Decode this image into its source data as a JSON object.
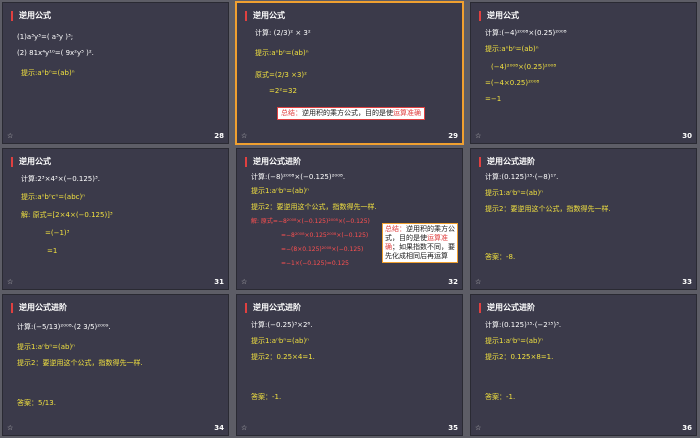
{
  "slides": [
    {
      "number": "28",
      "title": "逆用公式",
      "lines": [
        {
          "text": "(1)a³y³=( a³y )³;",
          "color": "w"
        },
        {
          "text": "(2) 81x⁴y¹⁰=( 9x²y⁵ )².",
          "color": "w"
        },
        {
          "text": "提示:aⁿbⁿ=(ab)ⁿ",
          "color": "y"
        }
      ]
    },
    {
      "number": "29",
      "title": "逆用公式",
      "lines": [
        {
          "text": "计算: (2/3)² × 3²",
          "color": "w"
        },
        {
          "text": "提示:aⁿbⁿ=(ab)ⁿ",
          "color": "y"
        },
        {
          "text": "原式=(2/3 ×3)²",
          "color": "y"
        },
        {
          "text": "=2²=32",
          "color": "y"
        }
      ],
      "note_prefix": "总结：",
      "note_body": "逆用积的乘方公式，目的是使",
      "note_highlight": "运算准确"
    },
    {
      "number": "30",
      "title": "逆用公式",
      "lines": [
        {
          "text": "计算:(−4)²⁰⁰⁸×(0.25)²⁰⁰⁸",
          "color": "w"
        },
        {
          "text": "提示:aⁿbⁿ=(ab)ⁿ",
          "color": "y"
        },
        {
          "text": "(−4)²⁰⁰⁸×(0.25)²⁰⁰⁸",
          "color": "y"
        },
        {
          "text": "=(−4×0.25)²⁰⁰⁸",
          "color": "y"
        },
        {
          "text": "=−1",
          "color": "y"
        }
      ]
    },
    {
      "number": "31",
      "title": "逆用公式",
      "lines": [
        {
          "text": "计算:2³×4³×(−0.125)³.",
          "color": "w"
        },
        {
          "text": "提示:aⁿbⁿcⁿ=(abc)ⁿ",
          "color": "y"
        },
        {
          "text": "解: 原式=[2×4×(−0.125)]³",
          "color": "y"
        },
        {
          "text": "=(−1)³",
          "color": "y"
        },
        {
          "text": "=1",
          "color": "y"
        }
      ]
    },
    {
      "number": "32",
      "title": "逆用公式进阶",
      "lines": [
        {
          "text": "计算:(−8)²⁰⁰⁸×(−0.125)²⁰⁰⁸.",
          "color": "w"
        },
        {
          "text": "提示1:aⁿbⁿ=(ab)ⁿ",
          "color": "y"
        },
        {
          "text": "提示2：要逆用这个公式，指数得先一样.",
          "color": "y"
        },
        {
          "text": "解: 原式=−8²⁰⁰⁸×(−0.125)²⁰⁰⁸×(−0.125)",
          "color": "r"
        },
        {
          "text": "=−8²⁰⁰⁸×0.125²⁰⁰⁸×(−0.125)",
          "color": "r"
        },
        {
          "text": "=−(8×0.125)²⁰⁰⁸×(−0.125)",
          "color": "r"
        },
        {
          "text": "=−1×(−0.125)=0.125",
          "color": "r"
        }
      ],
      "note_prefix": "总结：",
      "note_body": "逆用积的乘方公式，目的是使",
      "note_highlight": "运算准确",
      "note_tail": "；如果指数不同，要先化成相同后再运算"
    },
    {
      "number": "33",
      "title": "逆用公式进阶",
      "lines": [
        {
          "text": "计算:(0.125)¹⁵·(−8)¹⁷.",
          "color": "w"
        },
        {
          "text": "提示1:aⁿbⁿ=(ab)ⁿ",
          "color": "y"
        },
        {
          "text": "提示2：要逆用这个公式，指数得先一样.",
          "color": "y"
        },
        {
          "text": "答案：-8.",
          "color": "y"
        }
      ]
    },
    {
      "number": "34",
      "title": "逆用公式进阶",
      "lines": [
        {
          "text": "计算:(−5/13)²⁰⁰⁸·(2 3/5)²⁰⁰⁹.",
          "color": "w"
        },
        {
          "text": "提示1:aⁿbⁿ=(ab)ⁿ",
          "color": "y"
        },
        {
          "text": "提示2：要逆用这个公式，指数得先一样.",
          "color": "y"
        },
        {
          "text": "答案：5/13.",
          "color": "y"
        }
      ]
    },
    {
      "number": "35",
      "title": "逆用公式进阶",
      "lines": [
        {
          "text": "计算:(−0.25)³×2⁶.",
          "color": "w"
        },
        {
          "text": "提示1:aⁿbⁿ=(ab)ⁿ",
          "color": "y"
        },
        {
          "text": "提示2：0.25×4=1.",
          "color": "y"
        },
        {
          "text": "答案：-1.",
          "color": "y"
        }
      ]
    },
    {
      "number": "36",
      "title": "逆用公式进阶",
      "lines": [
        {
          "text": "计算:(0.125)¹⁵·(−2¹⁵)³.",
          "color": "w"
        },
        {
          "text": "提示1:aⁿbⁿ=(ab)ⁿ",
          "color": "y"
        },
        {
          "text": "提示2：0.125×8=1.",
          "color": "y"
        },
        {
          "text": "答案：-1.",
          "color": "y"
        }
      ]
    }
  ],
  "star_glyph": "☆",
  "selected_slide": "29"
}
